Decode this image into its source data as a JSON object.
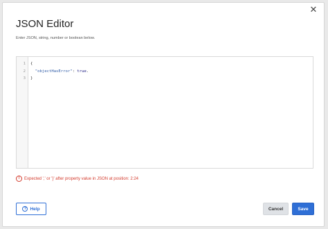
{
  "dialog": {
    "close_glyph": "✕",
    "title": "JSON Editor",
    "subtitle": "Enter JSON, string, number or boolean below."
  },
  "editor": {
    "line_numbers": [
      "1",
      "2",
      "3"
    ],
    "lines": [
      {
        "text": "{"
      },
      {
        "indent": "  ",
        "key": "\"objectHasError\"",
        "sep": ": ",
        "value": "true",
        "trail": "."
      },
      {
        "text": "}"
      }
    ]
  },
  "error": {
    "icon": "!",
    "message": "Expected ',' or '}' after property value in JSON at position: 2:24"
  },
  "buttons": {
    "help_icon": "?",
    "help_label": "Help",
    "cancel_label": "Cancel",
    "save_label": "Save"
  },
  "colors": {
    "accent": "#2f6fd6",
    "error": "#d33a2c"
  }
}
